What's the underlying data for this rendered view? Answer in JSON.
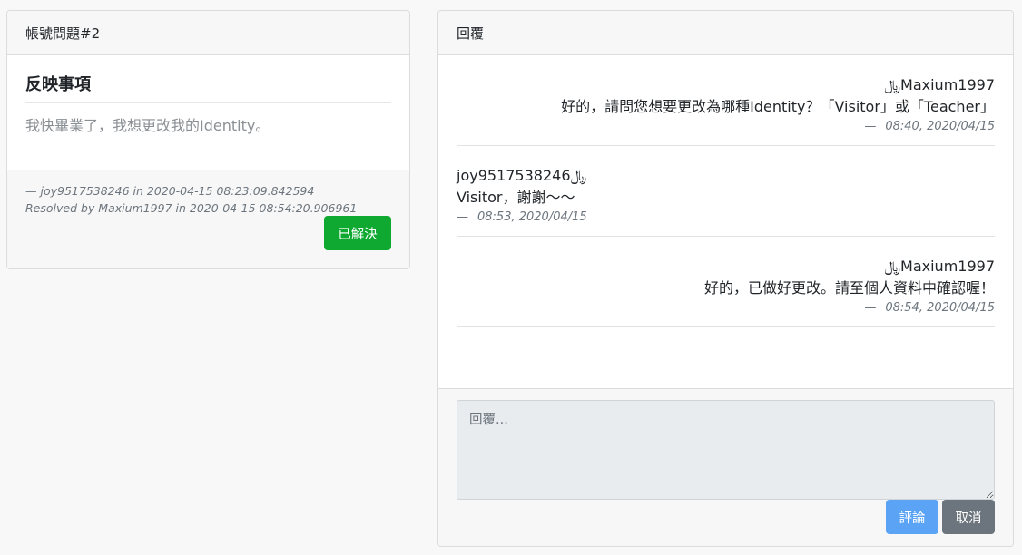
{
  "issue": {
    "header": "帳號問題#2",
    "title": "反映事項",
    "content": "我快畢業了，我想更改我的Identity。",
    "meta_created": "—  joy9517538246 in 2020-04-15 08:23:09.842594",
    "meta_resolved": "Resolved by Maxium1997 in 2020-04-15 08:54:20.906961",
    "status_button": "已解決"
  },
  "reply": {
    "header": "回覆",
    "messages": [
      {
        "author": "﷼Maxium1997",
        "text": "好的，請問您想要更改為哪種Identity？「Visitor」或「Teacher」",
        "dash": "—",
        "time": "08:40, 2020/04/15"
      },
      {
        "author": "joy9517538246﷼",
        "text": "Visitor，謝謝～～",
        "dash": "—",
        "time": "08:53, 2020/04/15"
      },
      {
        "author": "﷼Maxium1997",
        "text": "好的，已做好更改。請至個人資料中確認喔！",
        "dash": "—",
        "time": "08:54, 2020/04/15"
      }
    ],
    "textarea_placeholder": "回覆...",
    "comment_button": "評論",
    "cancel_button": "取消"
  },
  "colors": {
    "success": "#0fa931",
    "primary_light": "#5aa3f5",
    "secondary": "#6c757d"
  }
}
